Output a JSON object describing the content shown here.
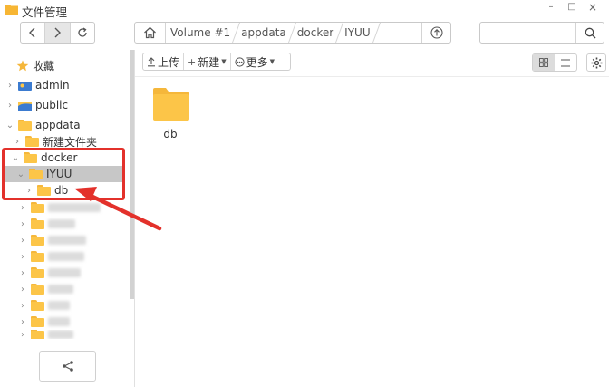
{
  "window": {
    "title": "文件管理",
    "minimize": "–",
    "maximize": "□",
    "close": "×"
  },
  "toolbar": {
    "back": "‹",
    "forward": "›",
    "refresh": "↻"
  },
  "path": {
    "crumbs": [
      "Volume #1",
      "appdata",
      "docker",
      "IYUU"
    ]
  },
  "search": {
    "value": "",
    "placeholder": ""
  },
  "sidebar": {
    "favorites_label": "收藏",
    "items": [
      {
        "label": "admin"
      },
      {
        "label": "public"
      },
      {
        "label": "appdata"
      },
      {
        "label": "新建文件夹"
      },
      {
        "label": "docker"
      },
      {
        "label": "IYUU"
      },
      {
        "label": "db"
      }
    ]
  },
  "actions": {
    "upload": "上传",
    "new": "新建",
    "more": "更多"
  },
  "files": [
    {
      "name": "db",
      "icon": "folder-icon"
    }
  ],
  "colors": {
    "folder": "#fcc548",
    "annotation": "#e3312b",
    "selected_row": "#c7c7c7"
  }
}
